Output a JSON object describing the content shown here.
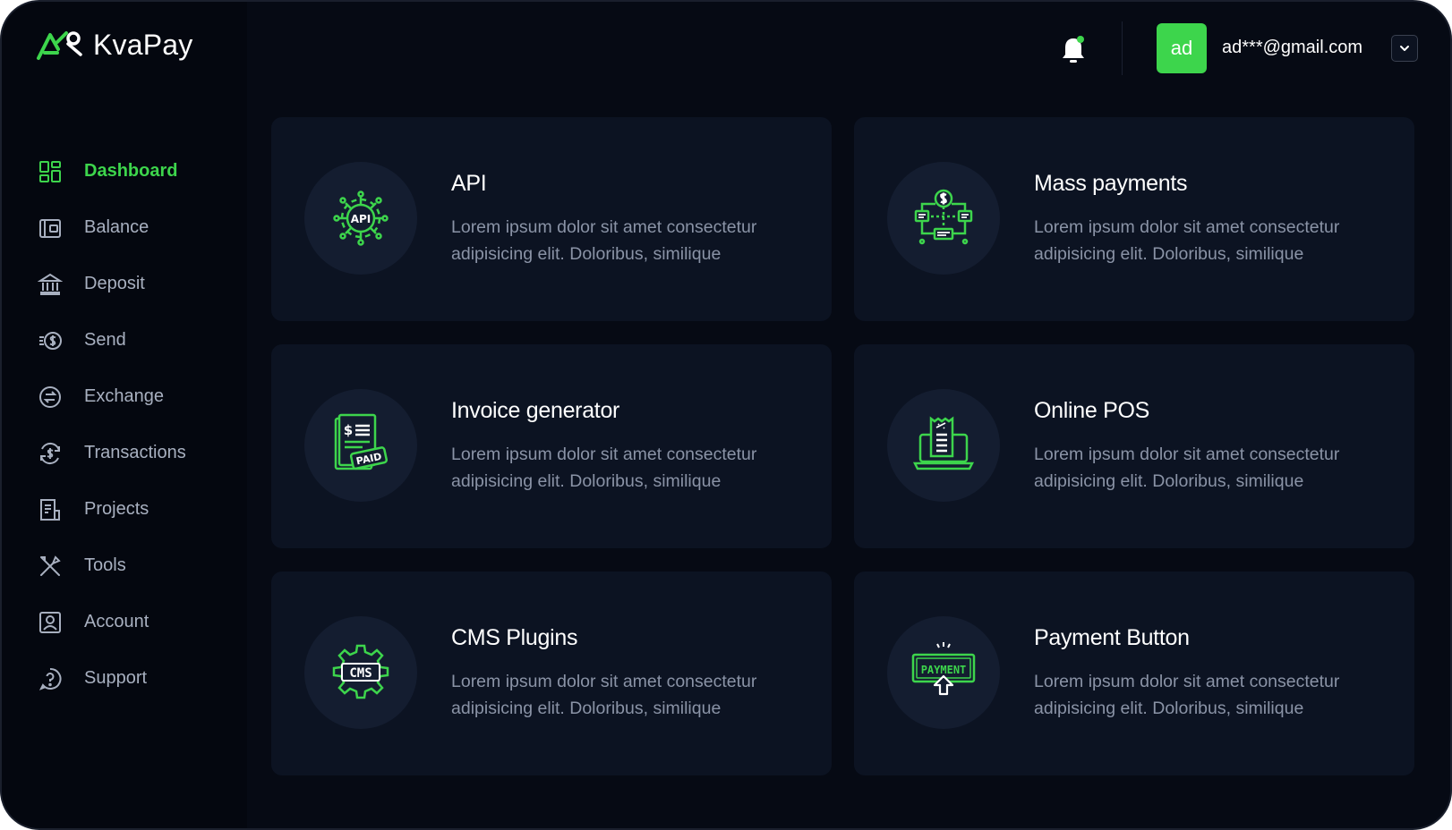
{
  "brand": {
    "name": "KvaPay",
    "accent": "#3dd54c"
  },
  "sidebar": {
    "items": [
      {
        "label": "Dashboard",
        "icon": "dashboard-icon",
        "active": true
      },
      {
        "label": "Balance",
        "icon": "wallet-icon",
        "active": false
      },
      {
        "label": "Deposit",
        "icon": "bank-icon",
        "active": false
      },
      {
        "label": "Send",
        "icon": "send-money-icon",
        "active": false
      },
      {
        "label": "Exchange",
        "icon": "exchange-icon",
        "active": false
      },
      {
        "label": "Transactions",
        "icon": "transactions-icon",
        "active": false
      },
      {
        "label": "Projects",
        "icon": "projects-icon",
        "active": false
      },
      {
        "label": "Tools",
        "icon": "tools-icon",
        "active": false
      },
      {
        "label": "Account",
        "icon": "account-icon",
        "active": false
      },
      {
        "label": "Support",
        "icon": "support-icon",
        "active": false
      }
    ]
  },
  "header": {
    "notification_icon": "bell-icon",
    "avatar_initials": "ad",
    "email": "ad***@gmail.com",
    "dropdown_icon": "chevron-down-icon"
  },
  "cards": [
    {
      "title": "API",
      "description": "Lorem ipsum dolor sit amet consectetur adipisicing elit. Doloribus, similique",
      "icon": "api-gear-icon"
    },
    {
      "title": "Mass payments",
      "description": "Lorem ipsum dolor sit amet consectetur adipisicing elit. Doloribus, similique",
      "icon": "mass-payments-icon"
    },
    {
      "title": "Invoice generator",
      "description": "Lorem ipsum dolor sit amet consectetur adipisicing elit. Doloribus, similique",
      "icon": "invoice-paid-icon",
      "icon_text_1": "$",
      "icon_text_2": "PAID"
    },
    {
      "title": "Online POS",
      "description": "Lorem ipsum dolor sit amet consectetur adipisicing elit. Doloribus, similique",
      "icon": "pos-terminal-icon"
    },
    {
      "title": "CMS Plugins",
      "description": "Lorem ipsum dolor sit amet consectetur adipisicing elit. Doloribus, similique",
      "icon": "cms-gear-icon",
      "icon_text": "CMS"
    },
    {
      "title": "Payment Button",
      "description": "Lorem ipsum dolor sit amet consectetur adipisicing elit. Doloribus, similique",
      "icon": "payment-button-icon",
      "icon_text": "PAYMENT"
    }
  ]
}
